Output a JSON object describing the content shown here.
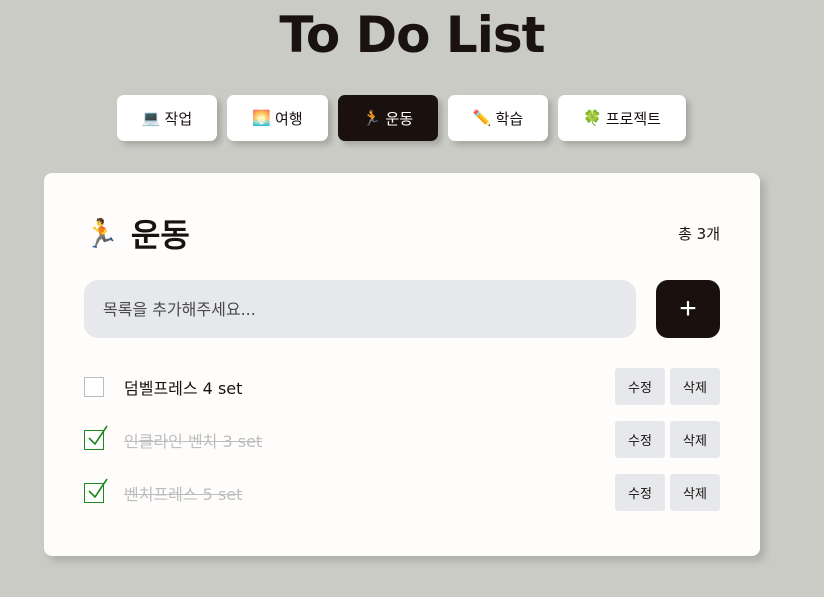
{
  "app": {
    "title": "To Do List"
  },
  "tabs": [
    {
      "emoji": "💻",
      "label": "작업",
      "active": false
    },
    {
      "emoji": "🌅",
      "label": "여행",
      "active": false
    },
    {
      "emoji": "🏃",
      "label": "운동",
      "active": true
    },
    {
      "emoji": "✏️",
      "label": "학습",
      "active": false
    },
    {
      "emoji": "🍀",
      "label": "프로젝트",
      "active": false
    }
  ],
  "section": {
    "emoji": "🏃",
    "title": "운동",
    "count": "총 3개"
  },
  "input": {
    "placeholder": "목록을 추가해주세요...",
    "value": "",
    "add_label": "+"
  },
  "todos": [
    {
      "text": "덤벨프레스 4 set",
      "done": false,
      "edit_label": "수정",
      "delete_label": "삭제"
    },
    {
      "text": "인클라인 벤치 3 set",
      "done": true,
      "edit_label": "수정",
      "delete_label": "삭제"
    },
    {
      "text": "벤치프레스 5 set",
      "done": true,
      "edit_label": "수정",
      "delete_label": "삭제"
    }
  ],
  "colors": {
    "background": "#cbcbc6",
    "accent": "#1a100d",
    "check": "#1c8a1c",
    "done_text": "#bdbdbd"
  }
}
